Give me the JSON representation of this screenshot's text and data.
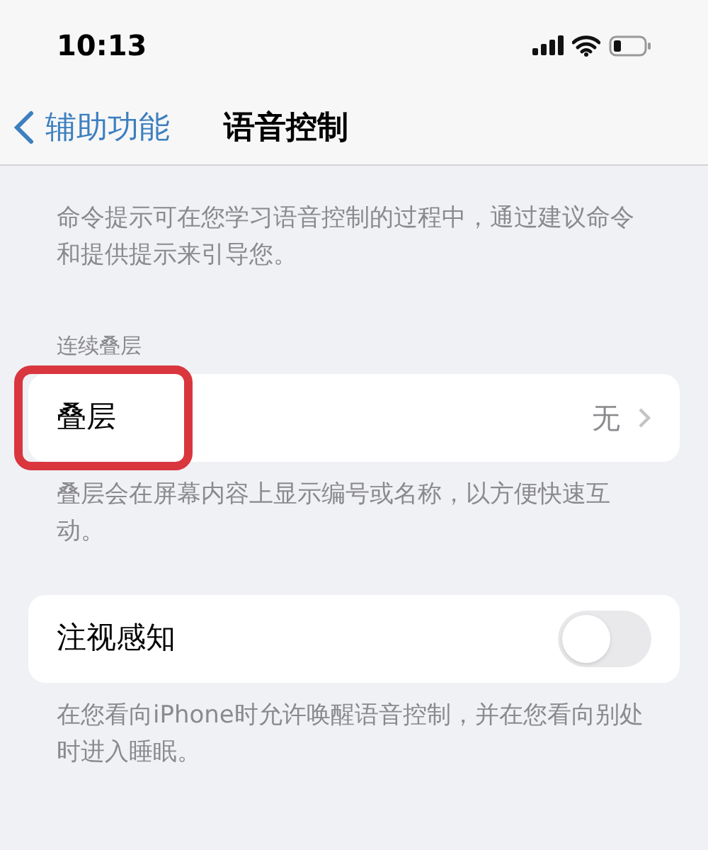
{
  "status_bar": {
    "time": "10:13"
  },
  "nav": {
    "back_label": "辅助功能",
    "title": "语音控制"
  },
  "sections": [
    {
      "kind": "footer_only",
      "footer": "命令提示可在您学习语音控制的过程中，通过建议命令和提供提示来引导您。"
    },
    {
      "kind": "disclosure",
      "header": "连续叠层",
      "label": "叠层",
      "value": "无",
      "highlighted": true,
      "footer": "叠层会在屏幕内容上显示编号或名称，以方便快速互动。"
    },
    {
      "kind": "toggle",
      "label": "注视感知",
      "on": false,
      "footer": "在您看向iPhone时允许唤醒语音控制，并在您看向别处时进入睡眠。"
    }
  ]
}
